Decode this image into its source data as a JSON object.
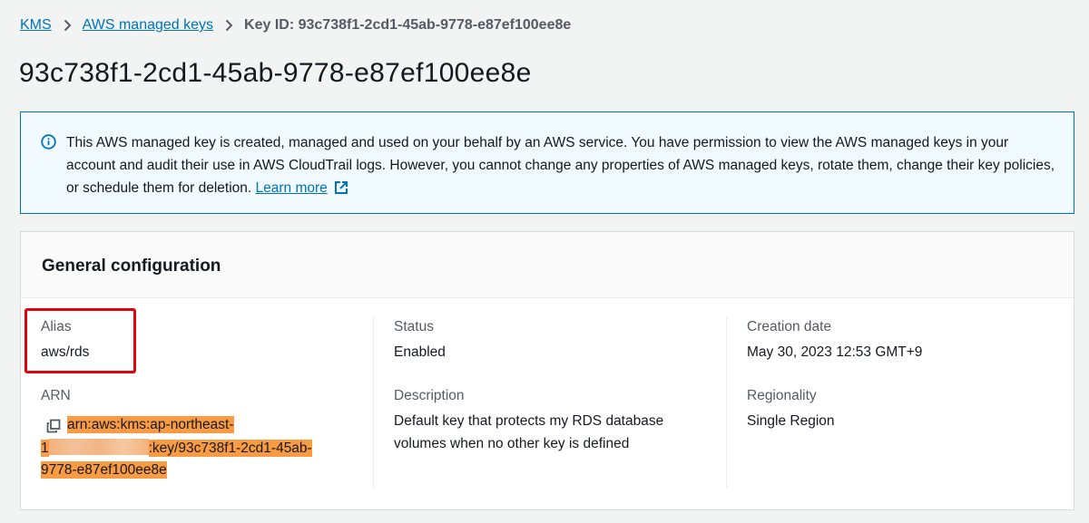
{
  "breadcrumb": {
    "items": [
      "KMS",
      "AWS managed keys"
    ],
    "current": "Key ID: 93c738f1-2cd1-45ab-9778-e87ef100ee8e"
  },
  "page": {
    "title": "93c738f1-2cd1-45ab-9778-e87ef100ee8e"
  },
  "info": {
    "text": "This AWS managed key is created, managed and used on your behalf by an AWS service. You have permission to view the AWS managed keys in your account and audit their use in AWS CloudTrail logs. However, you cannot change any properties of AWS managed keys, rotate them, change their key policies, or schedule them for deletion.",
    "link": "Learn more",
    "icon": "info-icon"
  },
  "general": {
    "title": "General configuration",
    "alias_label": "Alias",
    "alias_value": "aws/rds",
    "arn_label": "ARN",
    "arn_line1": "arn:aws:kms:ap-northeast-",
    "arn_line2_prefix": "1",
    "arn_line2_suffix": ":key/93c738f1-2cd1-45ab-",
    "arn_line3": "9778-e87ef100ee8e",
    "status_label": "Status",
    "status_value": "Enabled",
    "description_label": "Description",
    "description_value": "Default key that protects my RDS database volumes when no other key is defined",
    "creation_label": "Creation date",
    "creation_value": "May 30, 2023 12:53 GMT+9",
    "regionality_label": "Regionality",
    "regionality_value": "Single Region"
  },
  "colors": {
    "link": "#0073bb",
    "info_bg": "#f1faff",
    "highlight_box": "#e3000f",
    "arn_highlight": "#f89b43"
  }
}
